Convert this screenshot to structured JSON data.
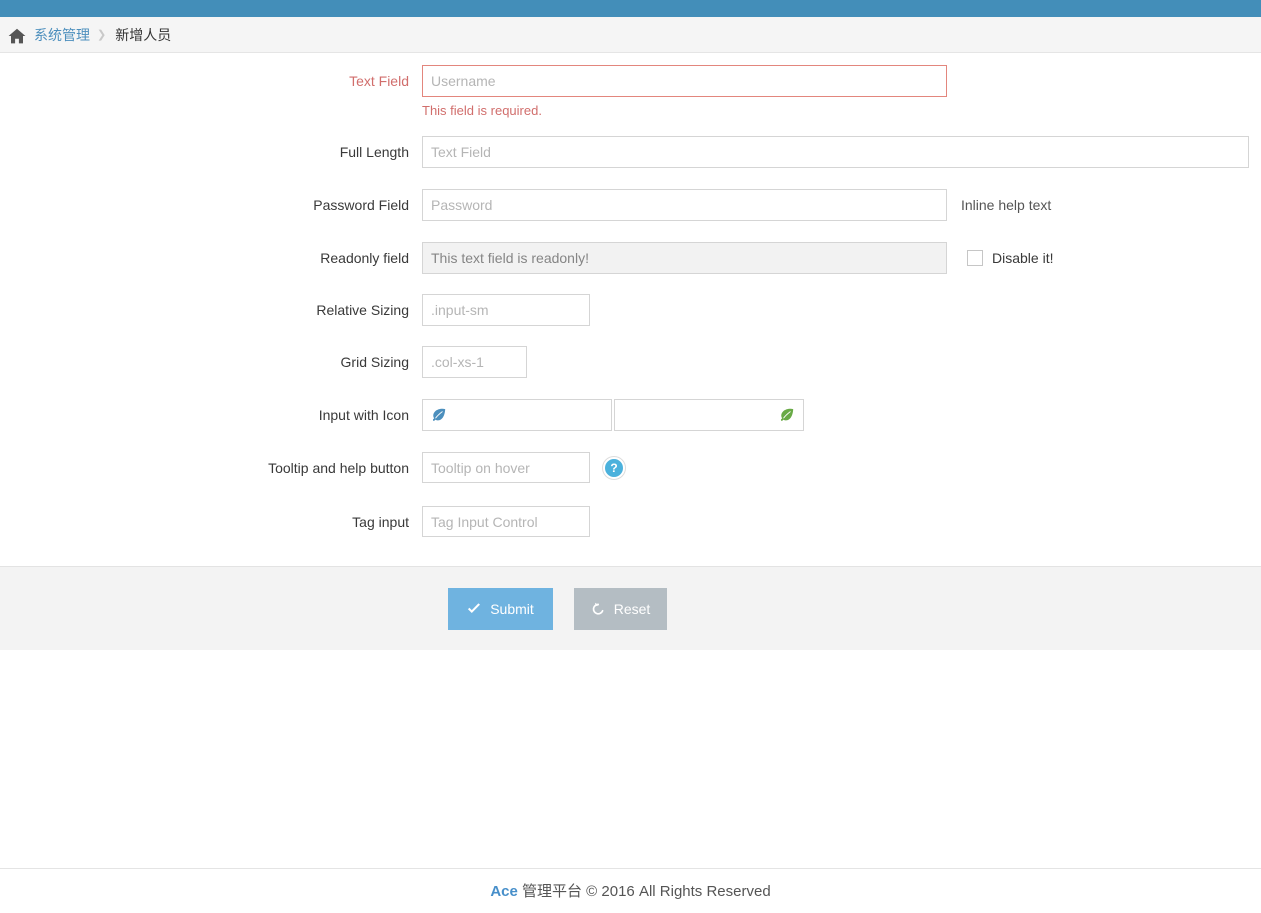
{
  "theme": {
    "topbar_color": "#438eb9",
    "brand_blue": "#478fca",
    "error_red": "#d16e6c",
    "submit_blue": "#6fb3e0",
    "reset_gray": "#b4bdc3",
    "help_blue": "#4bb1dc",
    "leaf_blue": "#4c8fbd",
    "leaf_green": "#69aa46"
  },
  "breadcrumb": {
    "home_icon": "home-icon",
    "separator": "❯",
    "items": [
      {
        "label": "系统管理",
        "link": true
      },
      {
        "label": "新增人员",
        "link": false
      }
    ]
  },
  "form": {
    "rows": [
      {
        "label": "Text Field",
        "placeholder": "Username",
        "error": "This field is required."
      },
      {
        "label": "Full Length",
        "placeholder": "Text Field"
      },
      {
        "label": "Password Field",
        "placeholder": "Password",
        "inline_help": "Inline help text"
      },
      {
        "label": "Readonly field",
        "value": "This text field is readonly!",
        "checkbox_label": "Disable it!"
      },
      {
        "label": "Relative Sizing",
        "placeholder": ".input-sm"
      },
      {
        "label": "Grid Sizing",
        "placeholder": ".col-xs-1"
      },
      {
        "label": "Input with Icon",
        "icon_left": "leaf-icon",
        "icon_right": "leaf-icon"
      },
      {
        "label": "Tooltip and help button",
        "placeholder": "Tooltip on hover",
        "help_icon": "question-mark-icon"
      },
      {
        "label": "Tag input",
        "placeholder": "Tag Input Control"
      }
    ]
  },
  "actions": {
    "submit_label": "Submit",
    "submit_icon": "check-icon",
    "reset_label": "Reset",
    "reset_icon": "undo-icon"
  },
  "footer": {
    "brand": "Ace",
    "text": "管理平台 © 2016 All Rights Reserved"
  }
}
